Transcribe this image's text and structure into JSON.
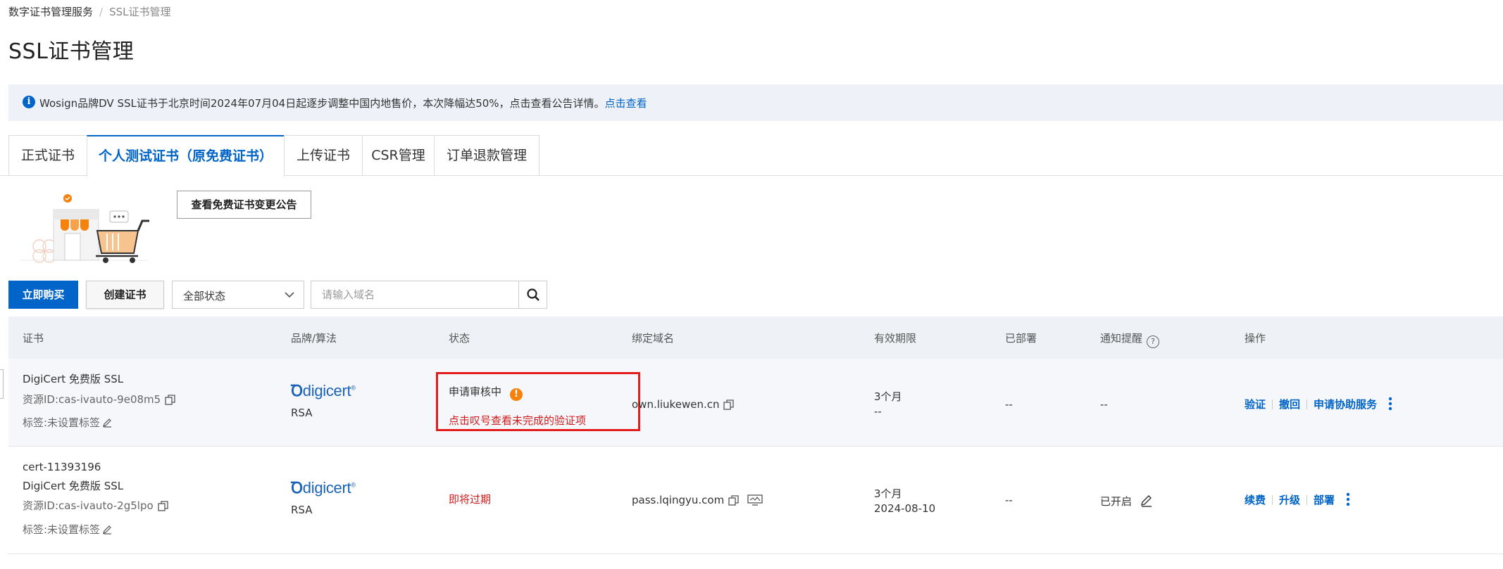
{
  "breadcrumb": {
    "root": "数字证书管理服务",
    "separator": "/",
    "current": "SSL证书管理"
  },
  "page_title": "SSL证书管理",
  "notice": {
    "text": "Wosign品牌DV SSL证书于北京时间2024年07月04日起逐步调整中国内地售价，本次降幅达50%，点击查看公告详情。",
    "link": "点击查看"
  },
  "tabs": [
    "正式证书",
    "个人测试证书（原免费证书）",
    "上传证书",
    "CSR管理",
    "订单退款管理"
  ],
  "active_tab": 1,
  "announce_button": "查看免费证书变更公告",
  "toolbar": {
    "buy": "立即购买",
    "create": "创建证书",
    "status_select": "全部状态",
    "search_placeholder": "请输入域名"
  },
  "table": {
    "headers": {
      "cert": "证书",
      "brand": "品牌/算法",
      "status": "状态",
      "domain": "绑定域名",
      "validity": "有效期限",
      "deployed": "已部署",
      "notify": "通知提醒",
      "ops": "操作"
    },
    "rows": [
      {
        "id_line": "",
        "name": "DigiCert 免费版 SSL",
        "resource": "资源ID:cas-ivauto-9e08m5",
        "tag": "标签:未设置标签",
        "brand": "digicert",
        "algo": "RSA",
        "status": "申请审核中",
        "status_hint": "点击叹号查看未完成的验证项",
        "domain": "own.liukewen.cn",
        "validity": "3个月",
        "expiry": "--",
        "deployed": "--",
        "notify": "--",
        "actions": [
          "验证",
          "撤回",
          "申请协助服务"
        ]
      },
      {
        "id_line": "cert-11393196",
        "name": "DigiCert 免费版 SSL",
        "resource": "资源ID:cas-ivauto-2g5lpo",
        "tag": "标签:未设置标签",
        "brand": "digicert",
        "algo": "RSA",
        "status": "即将过期",
        "domain": "pass.lqingyu.com",
        "validity": "3个月",
        "expiry": "2024-08-10",
        "deployed": "--",
        "notify": "已开启",
        "actions": [
          "续费",
          "升级",
          "部署"
        ]
      }
    ]
  },
  "colors": {
    "primary": "#0064c8",
    "danger": "#d21a1a",
    "warning": "#f5820c",
    "notice_bg": "#eef2f8"
  }
}
